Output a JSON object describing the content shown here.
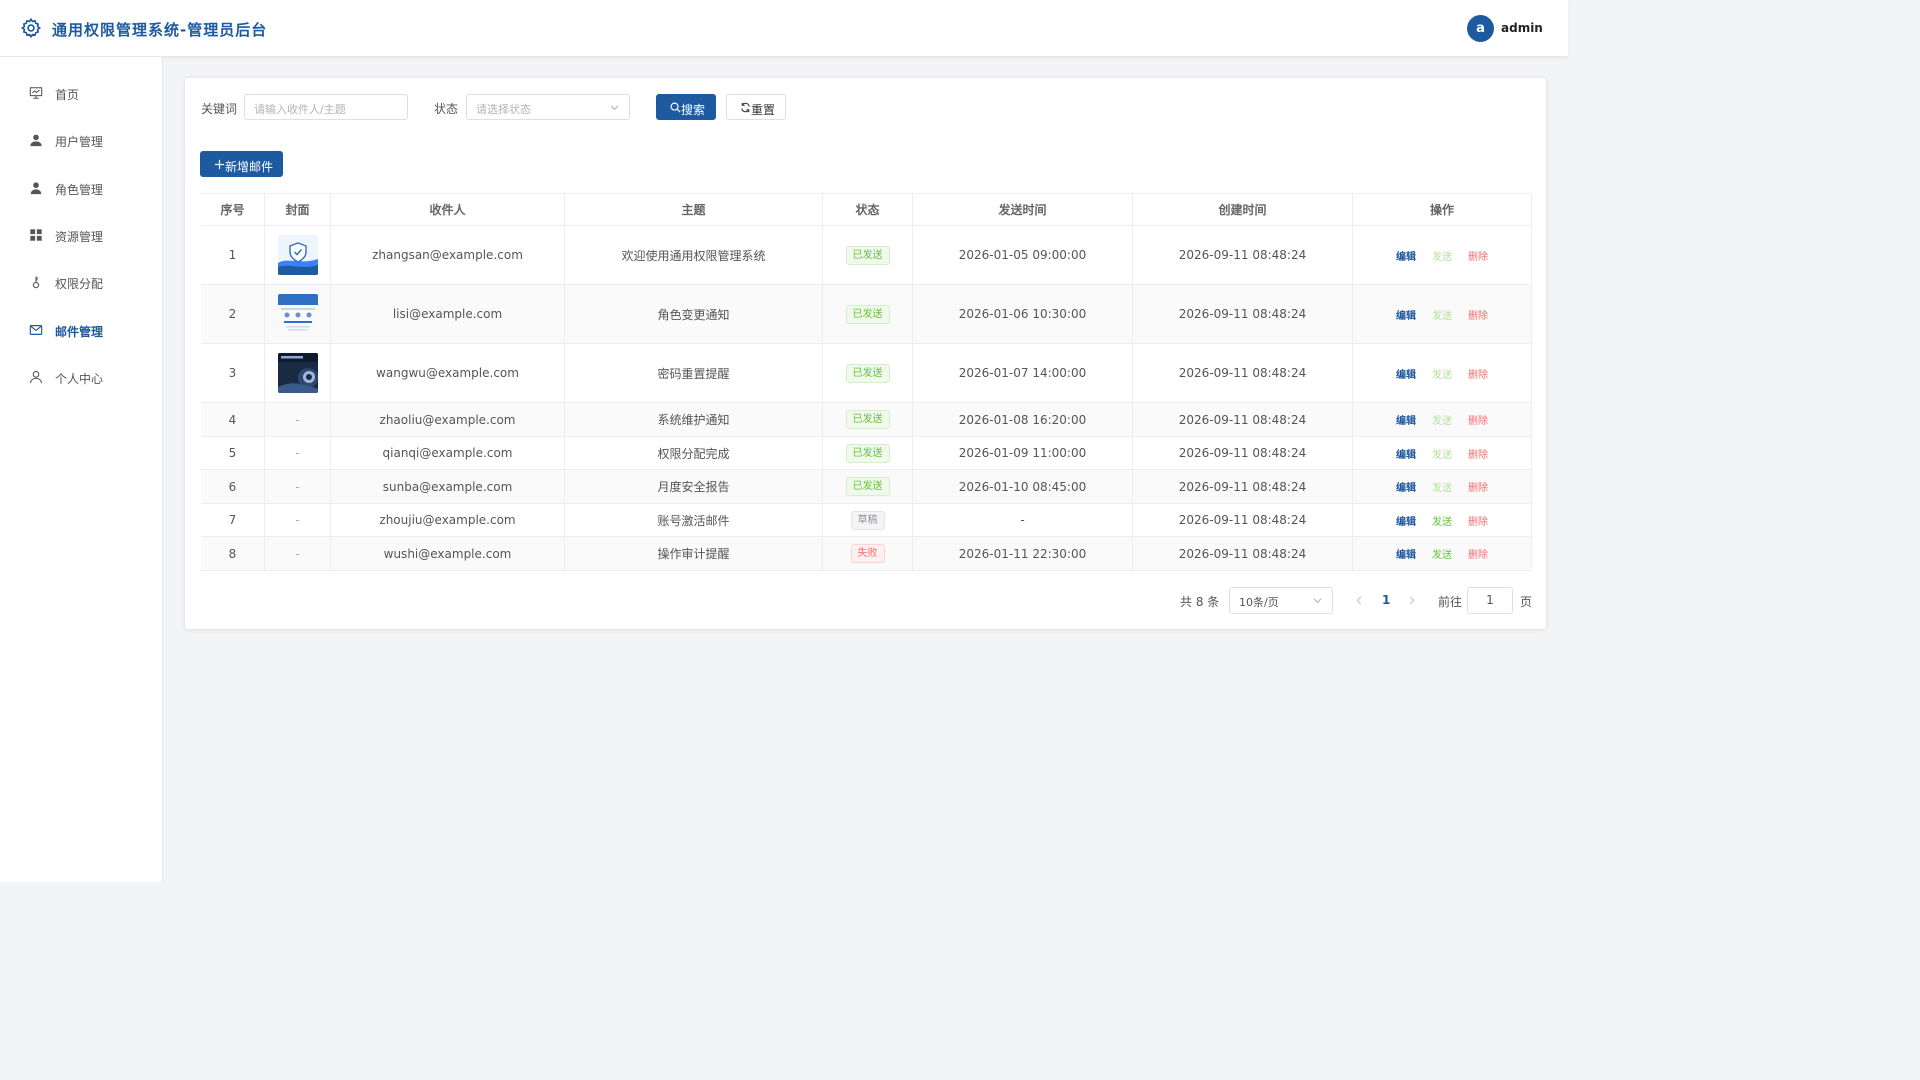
{
  "header": {
    "title": "通用权限管理系统-管理员后台",
    "avatar_letter": "a",
    "username": "admin"
  },
  "sidebar": {
    "items": [
      {
        "label": "首页",
        "icon": "dashboard-icon"
      },
      {
        "label": "用户管理",
        "icon": "user-icon"
      },
      {
        "label": "角色管理",
        "icon": "role-icon"
      },
      {
        "label": "资源管理",
        "icon": "grid-icon"
      },
      {
        "label": "权限分配",
        "icon": "key-icon"
      },
      {
        "label": "邮件管理",
        "icon": "mail-icon",
        "active": true
      },
      {
        "label": "个人中心",
        "icon": "person-icon"
      }
    ]
  },
  "filters": {
    "keyword_label": "关键词",
    "keyword_placeholder": "请输入收件人/主题",
    "status_label": "状态",
    "status_placeholder": "请选择状态",
    "search_label": "搜索",
    "reset_label": "重置"
  },
  "toolbar": {
    "add_label": "新增邮件"
  },
  "table": {
    "columns": [
      "序号",
      "封面",
      "收件人",
      "主题",
      "状态",
      "发送时间",
      "创建时间",
      "操作"
    ],
    "rows": [
      {
        "index": "1",
        "cover": "shield",
        "recipient": "zhangsan@example.com",
        "subject": "欢迎使用通用权限管理系统",
        "status": "已发送",
        "status_type": "sent",
        "send_time": "2026-01-05 09:00:00",
        "created": "2026-09-11 08:48:24"
      },
      {
        "index": "2",
        "cover": "doc",
        "recipient": "lisi@example.com",
        "subject": "角色变更通知",
        "status": "已发送",
        "status_type": "sent",
        "send_time": "2026-01-06 10:30:00",
        "created": "2026-09-11 08:48:24"
      },
      {
        "index": "3",
        "cover": "dark",
        "recipient": "wangwu@example.com",
        "subject": "密码重置提醒",
        "status": "已发送",
        "status_type": "sent",
        "send_time": "2026-01-07 14:00:00",
        "created": "2026-09-11 08:48:24"
      },
      {
        "index": "4",
        "cover": "-",
        "recipient": "zhaoliu@example.com",
        "subject": "系统维护通知",
        "status": "已发送",
        "status_type": "sent",
        "send_time": "2026-01-08 16:20:00",
        "created": "2026-09-11 08:48:24"
      },
      {
        "index": "5",
        "cover": "-",
        "recipient": "qianqi@example.com",
        "subject": "权限分配完成",
        "status": "已发送",
        "status_type": "sent",
        "send_time": "2026-01-09 11:00:00",
        "created": "2026-09-11 08:48:24"
      },
      {
        "index": "6",
        "cover": "-",
        "recipient": "sunba@example.com",
        "subject": "月度安全报告",
        "status": "已发送",
        "status_type": "sent",
        "send_time": "2026-01-10 08:45:00",
        "created": "2026-09-11 08:48:24"
      },
      {
        "index": "7",
        "cover": "-",
        "recipient": "zhoujiu@example.com",
        "subject": "账号激活邮件",
        "status": "草稿",
        "status_type": "draft",
        "send_time": "-",
        "created": "2026-09-11 08:48:24"
      },
      {
        "index": "8",
        "cover": "-",
        "recipient": "wushi@example.com",
        "subject": "操作审计提醒",
        "status": "失败",
        "status_type": "failed",
        "send_time": "2026-01-11 22:30:00",
        "created": "2026-09-11 08:48:24"
      }
    ],
    "actions": {
      "edit": "编辑",
      "send": "发送",
      "delete": "删除"
    }
  },
  "pagination": {
    "total_text": "共 8 条",
    "page_size": "10条/页",
    "current_page": "1",
    "goto_label": "前往",
    "goto_value": "1",
    "page_suffix": "页"
  },
  "colors": {
    "primary": "#1e5aa0",
    "success": "#67c23a",
    "danger": "#f56c6c",
    "muted": "#909399"
  }
}
